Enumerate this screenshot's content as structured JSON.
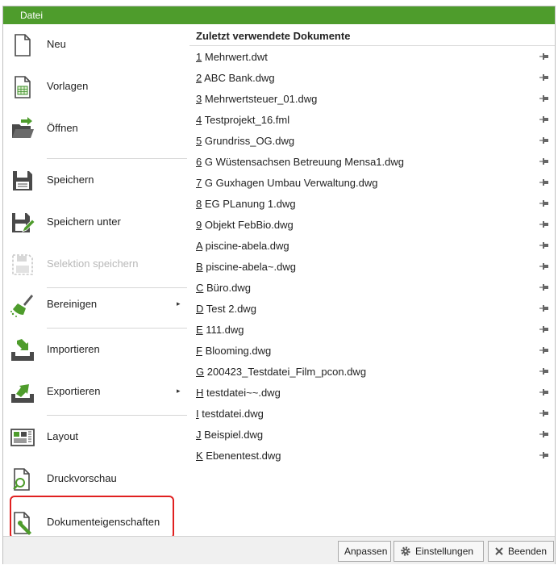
{
  "window": {
    "title": "Datei"
  },
  "menu": {
    "items": [
      {
        "label": "Neu"
      },
      {
        "label": "Vorlagen"
      },
      {
        "label": "Öffnen"
      },
      {
        "label": "Speichern"
      },
      {
        "label": "Speichern unter"
      },
      {
        "label": "Selektion speichern",
        "disabled": true
      },
      {
        "label": "Bereinigen",
        "submenu": true
      },
      {
        "label": "Importieren"
      },
      {
        "label": "Exportieren",
        "submenu": true
      },
      {
        "label": "Layout"
      },
      {
        "label": "Druckvorschau"
      },
      {
        "label": "Dokumenteigenschaften",
        "highlighted": true
      }
    ],
    "submenu_arrow": "▸"
  },
  "recent": {
    "title": "Zuletzt verwendete Dokumente",
    "docs": [
      {
        "key": "1",
        "name": "Mehrwert.dwt"
      },
      {
        "key": "2",
        "name": "ABC Bank.dwg"
      },
      {
        "key": "3",
        "name": "Mehrwertsteuer_01.dwg"
      },
      {
        "key": "4",
        "name": "Testprojekt_16.fml"
      },
      {
        "key": "5",
        "name": "Grundriss_OG.dwg"
      },
      {
        "key": "6",
        "name": "G Wüstensachsen Betreuung Mensa1.dwg"
      },
      {
        "key": "7",
        "name": "G Guxhagen Umbau Verwaltung.dwg"
      },
      {
        "key": "8",
        "name": "EG PLanung 1.dwg"
      },
      {
        "key": "9",
        "name": "Objekt FebBio.dwg"
      },
      {
        "key": "A",
        "name": "piscine-abela.dwg"
      },
      {
        "key": "B",
        "name": "piscine-abela~.dwg"
      },
      {
        "key": "C",
        "name": "Büro.dwg"
      },
      {
        "key": "D",
        "name": "Test 2.dwg"
      },
      {
        "key": "E",
        "name": "111.dwg"
      },
      {
        "key": "F",
        "name": "Blooming.dwg"
      },
      {
        "key": "G",
        "name": "200423_Testdatei_Film_pcon.dwg"
      },
      {
        "key": "H",
        "name": "testdatei~~.dwg"
      },
      {
        "key": "I",
        "name": "testdatei.dwg"
      },
      {
        "key": "J",
        "name": "Beispiel.dwg"
      },
      {
        "key": "K",
        "name": "Ebenentest.dwg"
      }
    ]
  },
  "buttons": {
    "customize": "Anpassen",
    "settings": "Einstellungen",
    "settings_icon": "gear-icon",
    "quit": "Beenden",
    "quit_icon": "x-icon"
  },
  "colors": {
    "titlebar": "#4e9c2c",
    "highlight_border": "#e02020"
  }
}
